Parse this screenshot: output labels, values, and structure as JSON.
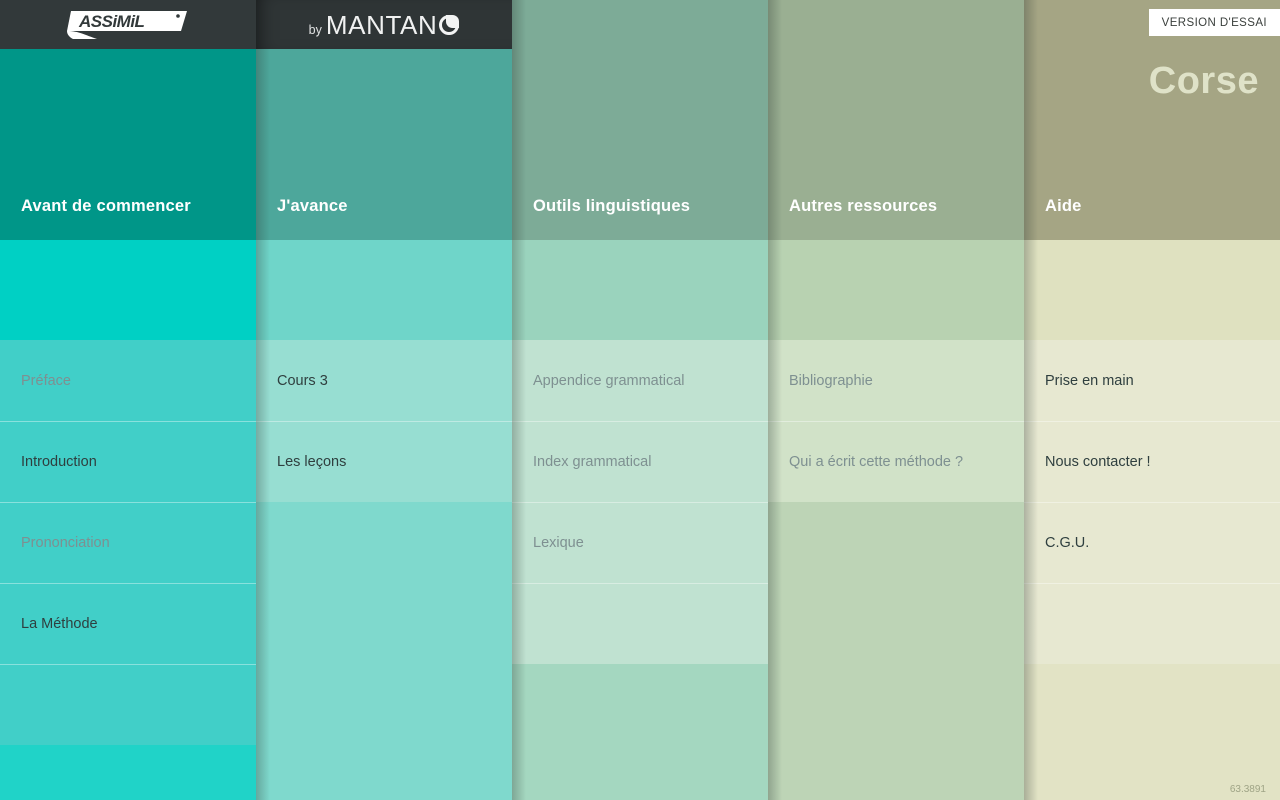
{
  "topbar": {
    "assimil_logo_alt": "ASSIMIL",
    "mantano_by": "by",
    "mantano_word": "MANTAN",
    "trial_badge": "VERSION D'ESSAI"
  },
  "page_title": "Corse",
  "version": "63.3891",
  "colors": {
    "col1_head": "#009688",
    "col2_head": "#4da79b",
    "col3_head": "#7dab97",
    "col4_head": "#9aaf92",
    "col5_head": "#a5a584",
    "col1_body": "#20d3c8",
    "col5_body": "#e2e3c5",
    "title": "#dfe2c8",
    "badge_bg": "#ffffff",
    "disabled_text": "#7e9091",
    "row_text": "#2f3f3f"
  },
  "columns": [
    {
      "id": "avant-de-commencer",
      "title": "Avant de commencer",
      "items": [
        {
          "label": "Préface",
          "disabled": true
        },
        {
          "label": "Introduction",
          "disabled": false
        },
        {
          "label": "Prononciation",
          "disabled": true
        },
        {
          "label": "La Méthode",
          "disabled": false
        }
      ]
    },
    {
      "id": "j-avance",
      "title": "J'avance",
      "items": [
        {
          "label": "Cours 3",
          "disabled": false
        },
        {
          "label": "Les leçons",
          "disabled": false
        }
      ]
    },
    {
      "id": "outils-linguistiques",
      "title": "Outils linguistiques",
      "items": [
        {
          "label": "Appendice grammatical",
          "disabled": true
        },
        {
          "label": "Index grammatical",
          "disabled": true
        },
        {
          "label": "Lexique",
          "disabled": true
        }
      ]
    },
    {
      "id": "autres-ressources",
      "title": "Autres ressources",
      "items": [
        {
          "label": "Bibliographie",
          "disabled": true
        },
        {
          "label": "Qui a écrit cette méthode ?",
          "disabled": true
        }
      ]
    },
    {
      "id": "aide",
      "title": "Aide",
      "items": [
        {
          "label": "Prise en main",
          "disabled": false
        },
        {
          "label": "Nous contacter !",
          "disabled": false
        },
        {
          "label": "C.G.U.",
          "disabled": false
        }
      ]
    }
  ]
}
